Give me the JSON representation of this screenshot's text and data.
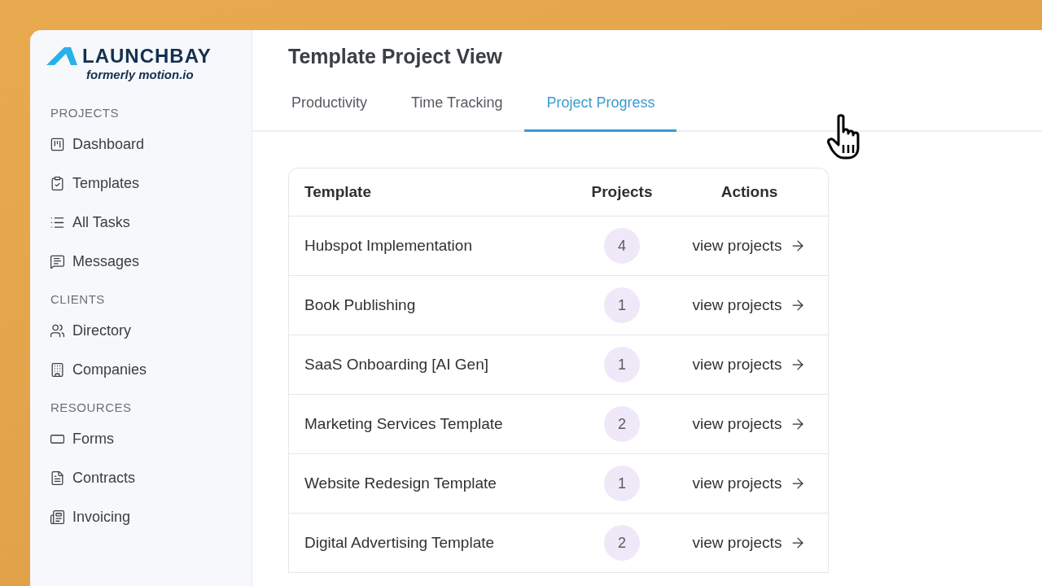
{
  "brand": {
    "name": "LAUNCHBAY",
    "tagline": "formerly motion.io"
  },
  "sidebar": {
    "sections": [
      {
        "heading": "PROJECTS",
        "items": [
          "Dashboard",
          "Templates",
          "All Tasks",
          "Messages"
        ]
      },
      {
        "heading": "CLIENTS",
        "items": [
          "Directory",
          "Companies"
        ]
      },
      {
        "heading": "RESOURCES",
        "items": [
          "Forms",
          "Contracts",
          "Invoicing"
        ]
      }
    ]
  },
  "page": {
    "title": "Template Project View"
  },
  "tabs": [
    {
      "label": "Productivity",
      "selected": false
    },
    {
      "label": "Time Tracking",
      "selected": false
    },
    {
      "label": "Project Progress",
      "selected": true
    }
  ],
  "table": {
    "columns": [
      "Template",
      "Projects",
      "Actions"
    ],
    "rows": [
      {
        "template": "Hubspot Implementation",
        "projects": "4",
        "action": "view projects"
      },
      {
        "template": "Book Publishing",
        "projects": "1",
        "action": "view projects"
      },
      {
        "template": "SaaS Onboarding [AI Gen]",
        "projects": "1",
        "action": "view projects"
      },
      {
        "template": "Marketing Services Template",
        "projects": "2",
        "action": "view projects"
      },
      {
        "template": "Website Redesign Template",
        "projects": "1",
        "action": "view projects"
      },
      {
        "template": "Digital Advertising Template",
        "projects": "2",
        "action": "view projects"
      }
    ]
  }
}
